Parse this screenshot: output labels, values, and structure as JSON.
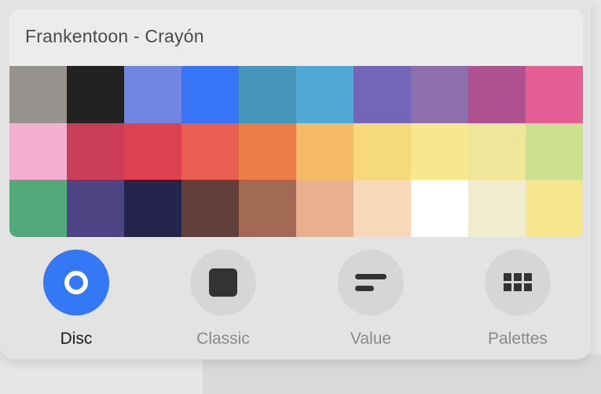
{
  "palette": {
    "name": "Frankentoon - Crayón",
    "swatches": [
      "#96938e",
      "#222222",
      "#7085e0",
      "#3875f6",
      "#4596b8",
      "#51a9d5",
      "#7366b8",
      "#8e6fae",
      "#b05192",
      "#e45f94",
      "#f3b0d0",
      "#ca3c58",
      "#dd404e",
      "#ea5f54",
      "#ed7d48",
      "#f4bb64",
      "#f6d97a",
      "#f7e78e",
      "#efe699",
      "#cde08f",
      "#52a97a",
      "#4e4585",
      "#24244d",
      "#623f3a",
      "#a26a55",
      "#e9b08e",
      "#f8d8b9",
      "#ffffff",
      "#f1ecd0",
      "#f7e690"
    ]
  },
  "tabs": [
    {
      "label": "Disc",
      "icon": "disc-icon",
      "active": true
    },
    {
      "label": "Classic",
      "icon": "square-icon",
      "active": false
    },
    {
      "label": "Value",
      "icon": "sliders-icon",
      "active": false
    },
    {
      "label": "Palettes",
      "icon": "grid-icon",
      "active": false
    }
  ],
  "colors": {
    "accent": "#3478f6",
    "inactive_circle": "#d6d6d6",
    "icon_dark": "#333333"
  }
}
